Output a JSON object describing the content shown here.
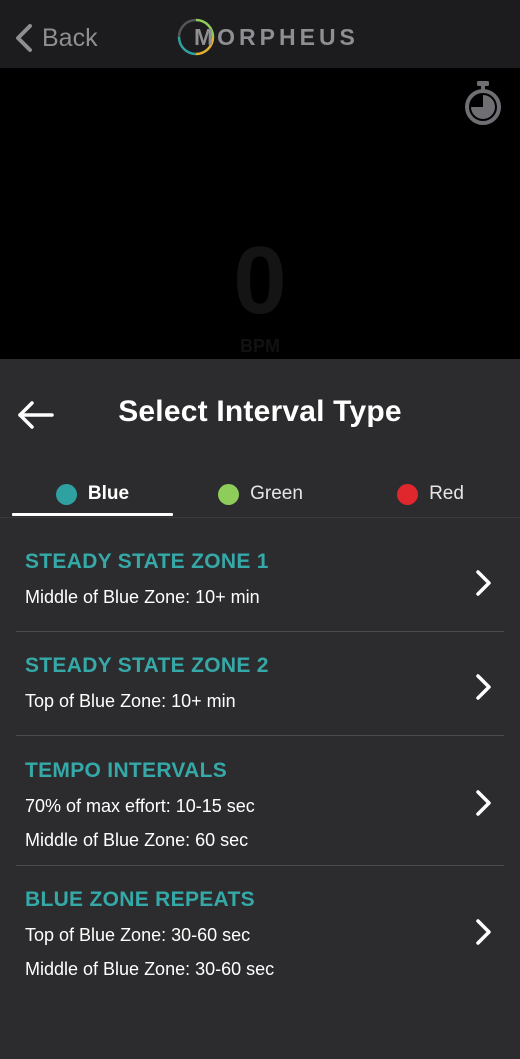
{
  "header": {
    "back_label": "Back",
    "logo_text": "MORPHEUS"
  },
  "screen": {
    "bpm_value": "0",
    "bpm_unit": "BPM"
  },
  "sheet": {
    "title": "Select Interval Type",
    "tabs": [
      {
        "label": "Blue",
        "color": "#2fa1a1",
        "active": true
      },
      {
        "label": "Green",
        "color": "#8fcd5a",
        "active": false
      },
      {
        "label": "Red",
        "color": "#e0272e",
        "active": false
      }
    ],
    "items": [
      {
        "title": "STEADY STATE ZONE 1",
        "lines": [
          "Middle of Blue Zone: 10+ min"
        ]
      },
      {
        "title": "STEADY STATE ZONE 2",
        "lines": [
          "Top of Blue Zone: 10+ min"
        ]
      },
      {
        "title": "TEMPO INTERVALS",
        "lines": [
          "70% of max effort: 10-15 sec",
          "Middle of Blue Zone: 60 sec"
        ]
      },
      {
        "title": "BLUE ZONE REPEATS",
        "lines": [
          "Top of Blue Zone: 30-60 sec",
          "Middle of Blue Zone: 30-60 sec"
        ]
      }
    ]
  },
  "colors": {
    "accent_teal": "#35a8a8",
    "sheet_bg": "#2c2c2e",
    "topbar_bg": "#1c1c1e"
  }
}
